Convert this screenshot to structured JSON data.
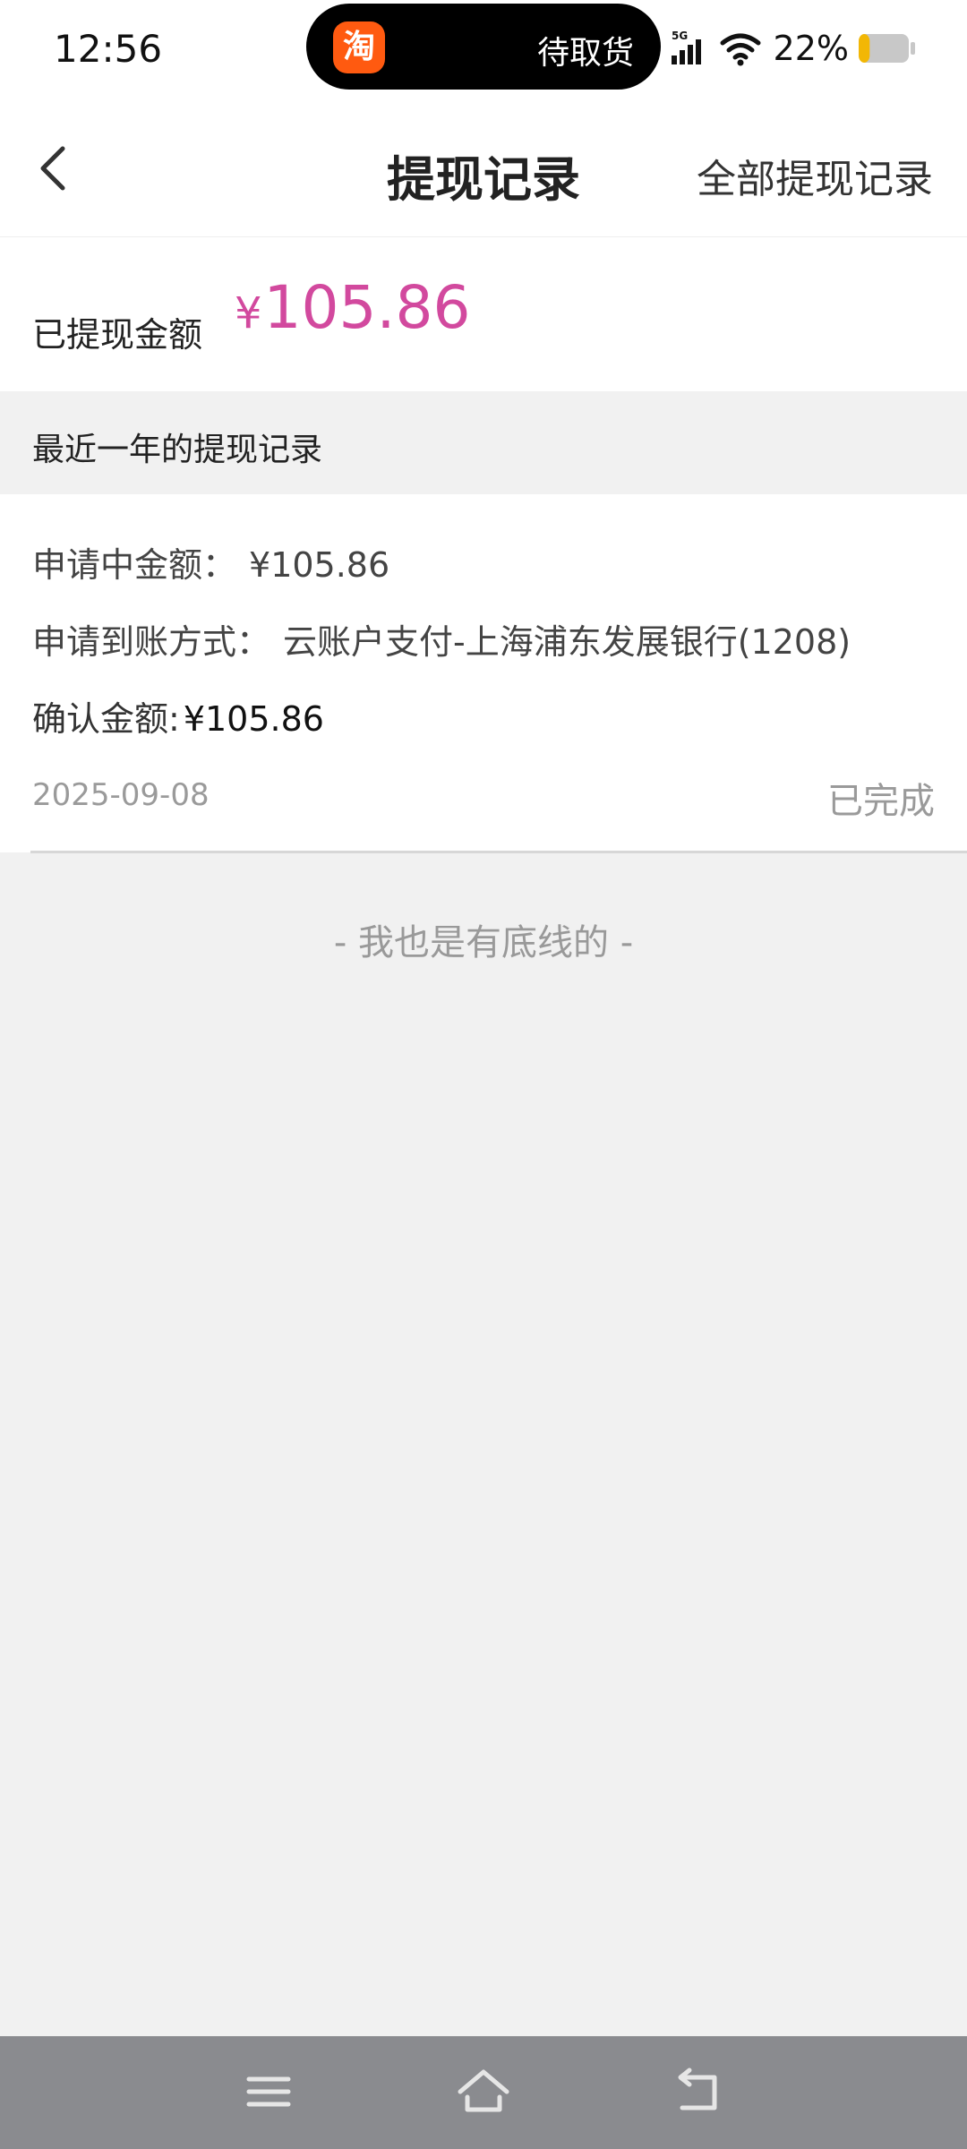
{
  "status_bar": {
    "time": "12:56",
    "island_app_icon": "淘",
    "island_text": "待取货",
    "network": "5G",
    "battery_percent": "22%",
    "battery_level": 0.22,
    "battery_color": "#f2b705"
  },
  "header": {
    "title": "提现记录",
    "action_label": "全部提现记录",
    "back_icon": "chevron-left-icon"
  },
  "summary": {
    "label": "已提现金额",
    "currency": "¥",
    "amount": "105.86",
    "accent_color": "#d2499e"
  },
  "section": {
    "title": "最近一年的提现记录"
  },
  "records": [
    {
      "applying_label": "申请中金额：",
      "applying_value": "¥105.86",
      "method_label": "申请到账方式：",
      "method_value": "云账户支付-上海浦东发展银行(1208)",
      "confirmed_label": "确认金额:",
      "confirmed_value": "¥105.86",
      "date": "2025-09-08",
      "status": "已完成"
    }
  ],
  "footer": {
    "bottom_text": "- 我也是有底线的 -"
  },
  "nav_bar": {
    "buttons": [
      "menu-icon",
      "home-icon",
      "back-icon"
    ]
  }
}
